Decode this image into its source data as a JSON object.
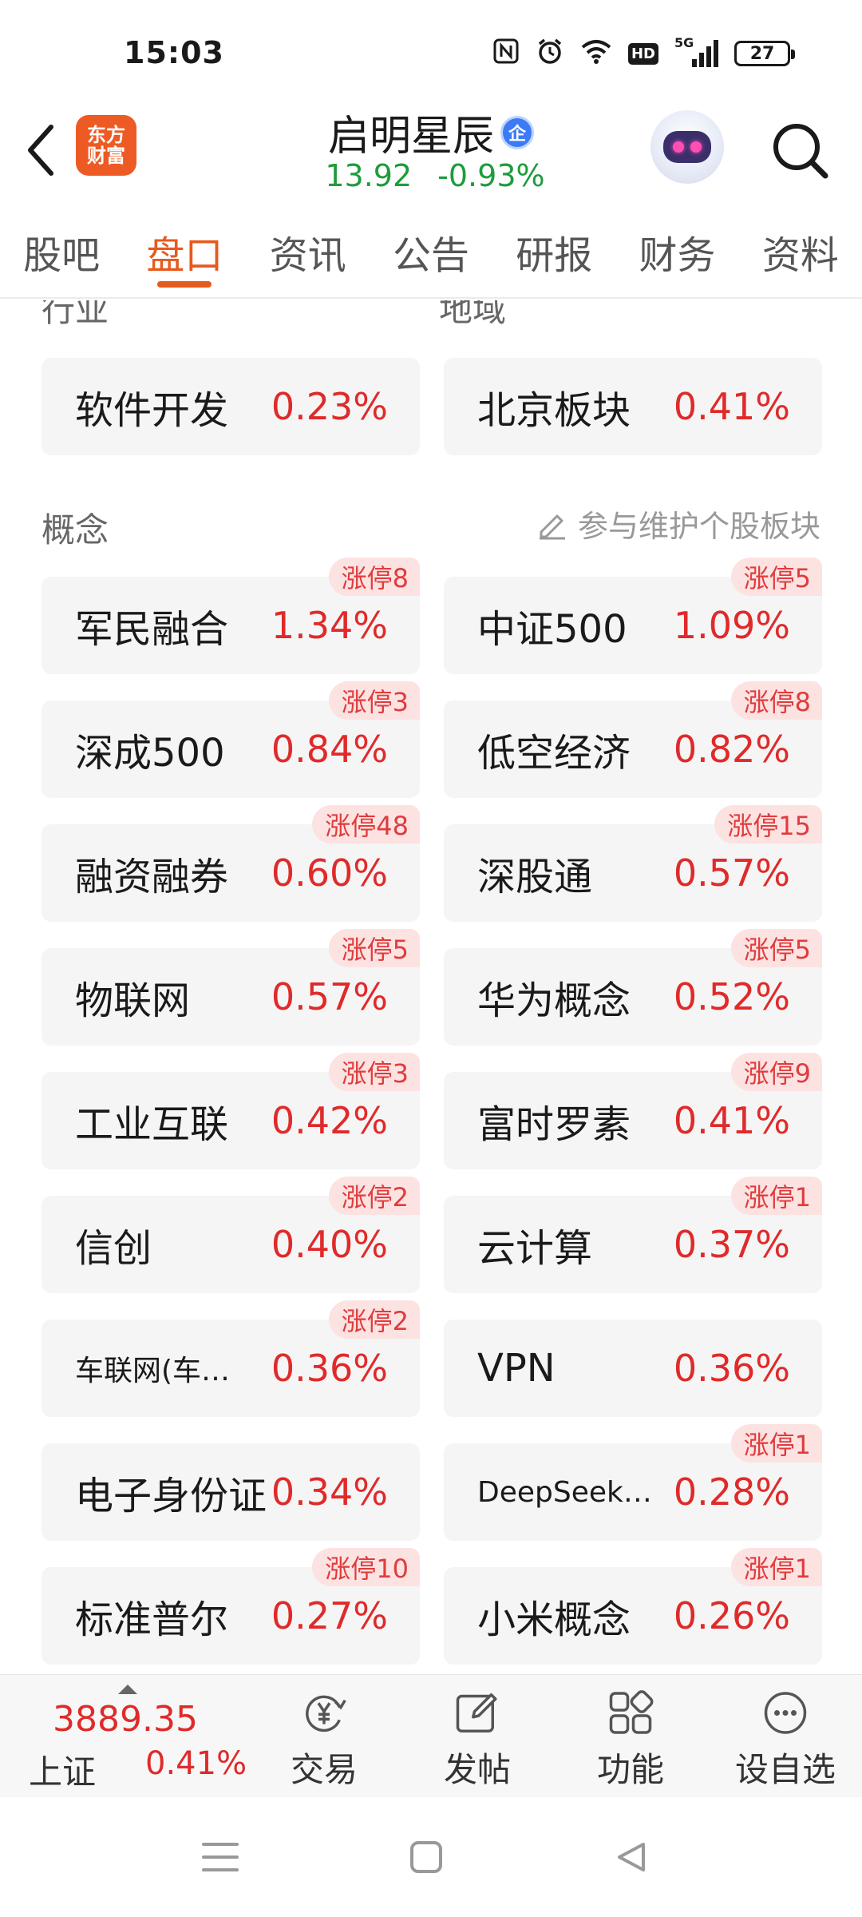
{
  "status_bar": {
    "time": "15:03",
    "network": "5G",
    "hd": "HD",
    "battery": "27"
  },
  "header": {
    "logo_line1": "东方",
    "logo_line2": "财富",
    "stock_name": "启明星辰",
    "stock_tag": "企",
    "price": "13.92",
    "change": "-0.93%",
    "price_color": "#1e9c3c"
  },
  "tabs": [
    {
      "label": "股吧",
      "active": false
    },
    {
      "label": "盘口",
      "active": true
    },
    {
      "label": "资讯",
      "active": false
    },
    {
      "label": "公告",
      "active": false
    },
    {
      "label": "研报",
      "active": false
    },
    {
      "label": "财务",
      "active": false
    },
    {
      "label": "资料",
      "active": false
    }
  ],
  "sections": {
    "industry_label": "行业",
    "region_label": "地域",
    "concept_label": "概念",
    "maintain_link": "参与维护个股板块"
  },
  "industry": {
    "name": "软件开发",
    "pct": "0.23%"
  },
  "region": {
    "name": "北京板块",
    "pct": "0.41%"
  },
  "concepts": [
    {
      "name": "军民融合",
      "pct": "1.34%",
      "badge": "涨停8"
    },
    {
      "name": "中证500",
      "pct": "1.09%",
      "badge": "涨停5"
    },
    {
      "name": "深成500",
      "pct": "0.84%",
      "badge": "涨停3"
    },
    {
      "name": "低空经济",
      "pct": "0.82%",
      "badge": "涨停8"
    },
    {
      "name": "融资融券",
      "pct": "0.60%",
      "badge": "涨停48"
    },
    {
      "name": "深股通",
      "pct": "0.57%",
      "badge": "涨停15"
    },
    {
      "name": "物联网",
      "pct": "0.57%",
      "badge": "涨停5"
    },
    {
      "name": "华为概念",
      "pct": "0.52%",
      "badge": "涨停5"
    },
    {
      "name": "工业互联",
      "pct": "0.42%",
      "badge": "涨停3"
    },
    {
      "name": "富时罗素",
      "pct": "0.41%",
      "badge": "涨停9"
    },
    {
      "name": "信创",
      "pct": "0.40%",
      "badge": "涨停2"
    },
    {
      "name": "云计算",
      "pct": "0.37%",
      "badge": "涨停1"
    },
    {
      "name": "车联网(车…",
      "pct": "0.36%",
      "badge": "涨停2"
    },
    {
      "name": "VPN",
      "pct": "0.36%",
      "badge": ""
    },
    {
      "name": "电子身份证",
      "pct": "0.34%",
      "badge": ""
    },
    {
      "name": "DeepSeek…",
      "pct": "0.28%",
      "badge": "涨停1"
    },
    {
      "name": "标准普尔",
      "pct": "0.27%",
      "badge": "涨停10"
    },
    {
      "name": "小米概念",
      "pct": "0.26%",
      "badge": "涨停1"
    }
  ],
  "bottom_bar": {
    "index_value": "3889.35",
    "index_name": "上证",
    "index_pct": "0.41%",
    "trade": "交易",
    "post": "发帖",
    "function": "功能",
    "watchlist": "设自选"
  },
  "colors": {
    "accent": "#e65a1e",
    "up": "#e02a2a",
    "down": "#1e9c3c",
    "badge_bg": "#fde2e2"
  }
}
